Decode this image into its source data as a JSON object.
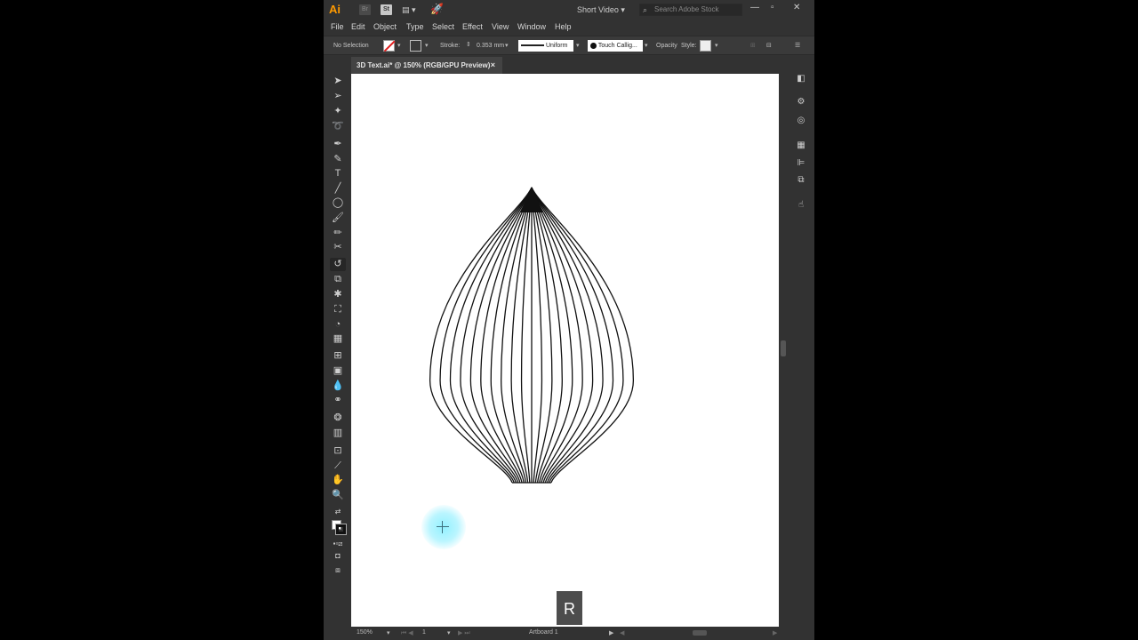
{
  "app": {
    "logo": "Ai",
    "bridge_label": "Br",
    "stock_label": "St",
    "workspace": "Short Video",
    "stock_search_placeholder": "Search Adobe Stock"
  },
  "menu": [
    "File",
    "Edit",
    "Object",
    "Type",
    "Select",
    "Effect",
    "View",
    "Window",
    "Help"
  ],
  "control_bar": {
    "selection": "No Selection",
    "stroke_label": "Stroke:",
    "stroke_value": "0.353 mm",
    "profile": "Uniform",
    "brush": "Touch Callig...",
    "opacity_label": "Opacity",
    "style_label": "Style:"
  },
  "document_tab": {
    "title": "3D Text.ai* @ 150% (RGB/GPU Preview)",
    "close": "×"
  },
  "status_bar": {
    "zoom": "150%",
    "artboard_number": "1",
    "artboard_name": "Artboard 1"
  },
  "key_overlay": "R",
  "tools": [
    "selection-tool-icon",
    "direct-selection-tool-icon",
    "magic-wand-tool-icon",
    "lasso-tool-icon",
    "pen-tool-icon",
    "curvature-tool-icon",
    "type-tool-icon",
    "line-tool-icon",
    "ellipse-tool-icon",
    "paintbrush-tool-icon",
    "pencil-tool-icon",
    "scissors-tool-icon",
    "rotate-tool-icon",
    "scale-tool-icon",
    "puppet-warp-tool-icon",
    "free-transform-tool-icon",
    "shape-builder-tool-icon",
    "perspective-grid-tool-icon",
    "mesh-tool-icon",
    "gradient-tool-icon",
    "eyedropper-tool-icon",
    "blend-tool-icon",
    "symbol-sprayer-tool-icon",
    "column-graph-tool-icon",
    "artboard-tool-icon",
    "slice-tool-icon",
    "hand-tool-icon",
    "zoom-tool-icon"
  ],
  "active_tool": "rotate-tool-icon",
  "artwork": {
    "shape": "teardrop-line-blend",
    "line_count": 21,
    "stroke_color": "#111111"
  }
}
